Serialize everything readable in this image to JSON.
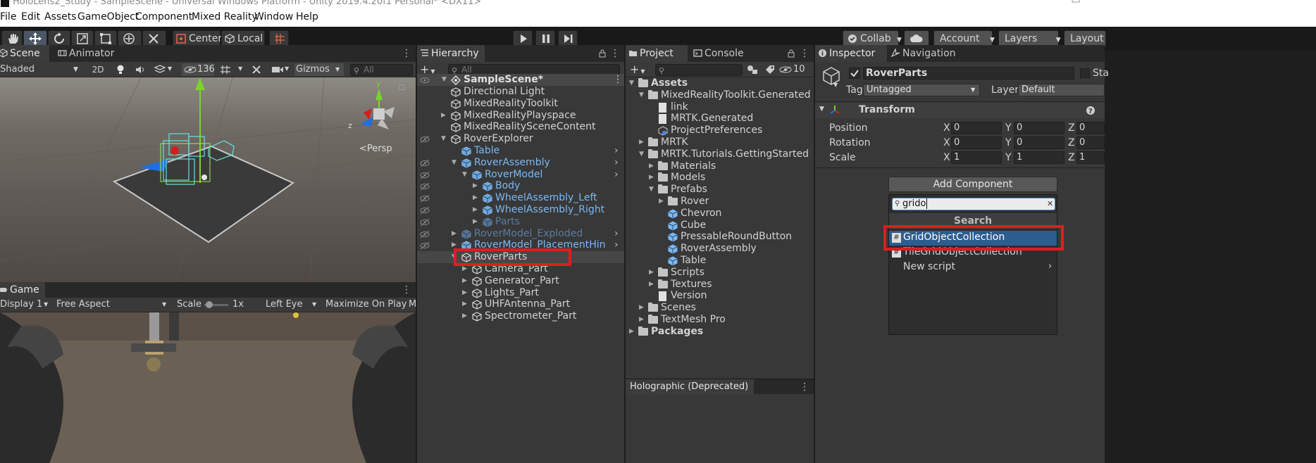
{
  "window": {
    "title": "HoloLens2_Study - SampleScene - Universal Windows Platform - Unity 2019.4.20f1 Personal* <DX11>"
  },
  "menu": [
    "File",
    "Edit",
    "Assets",
    "GameObject",
    "Component",
    "Mixed Reality",
    "Window",
    "Help"
  ],
  "toolbar": {
    "pivot": "Center",
    "space": "Local",
    "collab": "Collab",
    "account": "Account",
    "layers": "Layers",
    "layout": "Layout"
  },
  "scene": {
    "tabs": [
      "Scene",
      "Animator"
    ],
    "shading": "Shaded",
    "mode2d": "2D",
    "hidden_count": "136",
    "gizmos": "Gizmos",
    "search_placeholder": "All",
    "persp": "<Persp"
  },
  "game": {
    "tab": "Game",
    "display": "Display 1",
    "aspect": "Free Aspect",
    "scale_label": "Scale",
    "scale_value": "1x",
    "eye": "Left Eye",
    "maximize": "Maximize On Play",
    "mute": "M"
  },
  "hierarchy": {
    "tab": "Hierarchy",
    "search_placeholder": "All",
    "scene_name": "SampleScene*",
    "items": [
      {
        "label": "Directional Light",
        "style": "normal"
      },
      {
        "label": "MixedRealityToolkit",
        "style": "normal"
      },
      {
        "label": "MixedRealityPlayspace",
        "style": "normal"
      },
      {
        "label": "MixedRealitySceneContent",
        "style": "normal"
      },
      {
        "label": "RoverExplorer",
        "style": "normal"
      },
      {
        "label": "Table",
        "style": "prefab"
      },
      {
        "label": "RoverAssembly",
        "style": "prefab"
      },
      {
        "label": "RoverModel",
        "style": "prefab"
      },
      {
        "label": "Body",
        "style": "prefab"
      },
      {
        "label": "WheelAssembly_Left",
        "style": "prefab"
      },
      {
        "label": "WheelAssembly_Right",
        "style": "prefab"
      },
      {
        "label": "Parts",
        "style": "inactive"
      },
      {
        "label": "RoverModel_Exploded",
        "style": "inactive"
      },
      {
        "label": "RoverModel_PlacementHin",
        "style": "prefab"
      },
      {
        "label": "RoverParts",
        "style": "normal"
      },
      {
        "label": "Camera_Part",
        "style": "normal"
      },
      {
        "label": "Generator_Part",
        "style": "normal"
      },
      {
        "label": "Lights_Part",
        "style": "normal"
      },
      {
        "label": "UHFAntenna_Part",
        "style": "normal"
      },
      {
        "label": "Spectrometer_Part",
        "style": "normal"
      }
    ]
  },
  "project": {
    "tabs": [
      "Project",
      "Console"
    ],
    "hidden_count": "10",
    "items": [
      {
        "label": "Assets",
        "kind": "folder"
      },
      {
        "label": "MixedRealityToolkit.Generated",
        "kind": "folder"
      },
      {
        "label": "link",
        "kind": "file"
      },
      {
        "label": "MRTK.Generated",
        "kind": "file"
      },
      {
        "label": "ProjectPreferences",
        "kind": "asset"
      },
      {
        "label": "MRTK",
        "kind": "folder"
      },
      {
        "label": "MRTK.Tutorials.GettingStarted",
        "kind": "folder"
      },
      {
        "label": "Materials",
        "kind": "folder"
      },
      {
        "label": "Models",
        "kind": "folder"
      },
      {
        "label": "Prefabs",
        "kind": "folder"
      },
      {
        "label": "Rover",
        "kind": "folder"
      },
      {
        "label": "Chevron",
        "kind": "prefab"
      },
      {
        "label": "Cube",
        "kind": "prefab"
      },
      {
        "label": "PressableRoundButton",
        "kind": "prefab"
      },
      {
        "label": "RoverAssembly",
        "kind": "prefab"
      },
      {
        "label": "Table",
        "kind": "prefab"
      },
      {
        "label": "Scripts",
        "kind": "folder"
      },
      {
        "label": "Textures",
        "kind": "folder"
      },
      {
        "label": "Version",
        "kind": "file"
      },
      {
        "label": "Scenes",
        "kind": "folder"
      },
      {
        "label": "TextMesh Pro",
        "kind": "folder"
      },
      {
        "label": "Packages",
        "kind": "folder"
      }
    ],
    "bottom_tab": "Holographic (Deprecated)"
  },
  "inspector": {
    "tabs": [
      "Inspector",
      "Navigation"
    ],
    "object_name": "RoverParts",
    "static_label": "Sta",
    "tag_label": "Tag",
    "tag_value": "Untagged",
    "layer_label": "Layer",
    "layer_value": "Default",
    "transform": {
      "title": "Transform",
      "rows": [
        {
          "label": "Position",
          "x": "0",
          "y": "0",
          "z": "0"
        },
        {
          "label": "Rotation",
          "x": "0",
          "y": "0",
          "z": "0"
        },
        {
          "label": "Scale",
          "x": "1",
          "y": "1",
          "z": "1"
        }
      ],
      "axis_x": "X",
      "axis_y": "Y",
      "axis_z": "Z"
    },
    "add_component": {
      "button": "Add Component",
      "search_value": "grido",
      "header": "Search",
      "results": [
        "GridObjectCollection",
        "TileGridObjectCollection"
      ],
      "new_script": "New script"
    }
  },
  "colors": {
    "highlight": "#e21b23",
    "selection": "#2c5d8f",
    "prefab_blue": "#7ab8f5"
  }
}
